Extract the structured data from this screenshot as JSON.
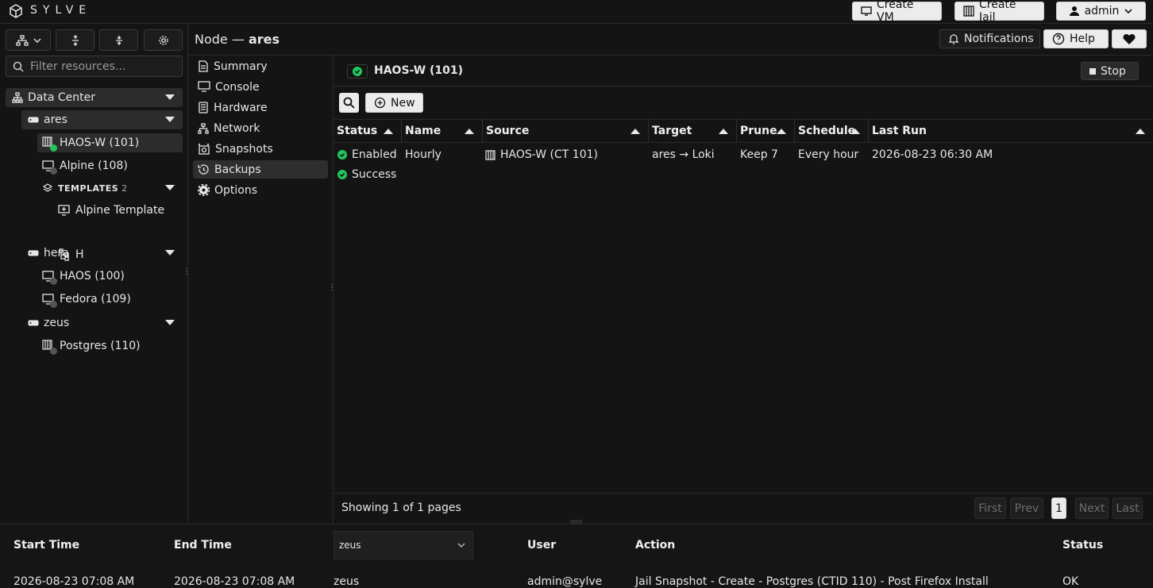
{
  "app": {
    "logo_text": "SYLVE"
  },
  "topbar": {
    "create_vm": "Create VM",
    "create_jail": "Create Jail",
    "user": "admin"
  },
  "header": {
    "node_prefix": "Node —",
    "node_name": "ares",
    "notifications": "Notifications",
    "help": "Help"
  },
  "sidebar": {
    "filter_placeholder": "Filter resources...",
    "datacenter": "Data Center",
    "nodes": [
      {
        "name": "ares",
        "items": [
          "HAOS-W (101)",
          "Alpine (108)"
        ],
        "templates_label": "TEMPLATES",
        "templates_count": "2",
        "templates": [
          "Alpine Template",
          "H"
        ]
      },
      {
        "name": "hera",
        "items": [
          "HAOS (100)",
          "Fedora (109)"
        ]
      },
      {
        "name": "zeus",
        "items": [
          "Postgres (110)"
        ]
      }
    ]
  },
  "nav": {
    "items": [
      "Summary",
      "Console",
      "Hardware",
      "Network",
      "Snapshots",
      "Backups",
      "Options"
    ],
    "selected": "Backups"
  },
  "main": {
    "title": "HAOS-W (101)",
    "stop": "Stop",
    "new": "New",
    "columns": [
      "Status",
      "Name",
      "Source",
      "Target",
      "Prune",
      "Schedule",
      "Last Run"
    ],
    "row": {
      "status1": "Enabled",
      "status2": "Success",
      "name": "Hourly",
      "source": "HAOS-W (CT 101)",
      "target": "ares → Loki",
      "prune": "Keep 7",
      "schedule": "Every hour",
      "last_run": "2026-08-23 06:30 AM"
    },
    "pagination": {
      "summary": "Showing 1 of 1 pages",
      "first": "First",
      "prev": "Prev",
      "page": "1",
      "next": "Next",
      "last": "Last"
    }
  },
  "logs": {
    "columns": [
      "Start Time",
      "End Time",
      "User",
      "Action",
      "Status"
    ],
    "node_filter": "zeus",
    "row": {
      "start": "2026-08-23 07:08 AM",
      "end": "2026-08-23 07:08 AM",
      "node": "zeus",
      "user": "admin@sylve",
      "action": "Jail Snapshot - Create - Postgres (CTID 110) - Post Firefox Install",
      "status": "OK"
    }
  },
  "colors": {
    "accent_ok": "#22c55e",
    "bg": "#141414",
    "selected": "#2c2c2c"
  }
}
